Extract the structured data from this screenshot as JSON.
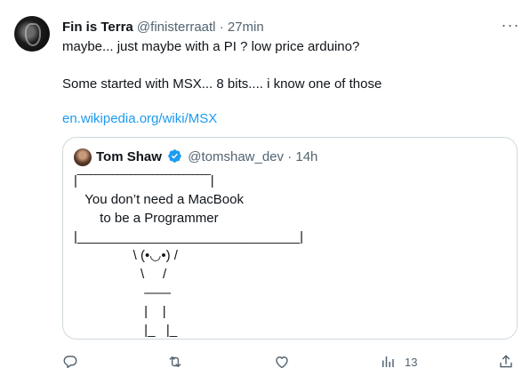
{
  "tweet": {
    "author_name": "Fin is Terra",
    "author_handle": "@finisterraatl",
    "separator": "·",
    "time": "27min",
    "line1": "maybe... just maybe with a PI ? low price arduino?",
    "line2": "Some started  with MSX... 8 bits.... i know one of those",
    "link": "en.wikipedia.org/wiki/MSX",
    "more_icon": "more-horizontal-icon"
  },
  "quote": {
    "author_name": "Tom Shaw",
    "author_handle": "@tomshaw_dev",
    "separator": "·",
    "time": "14h",
    "verified_icon": "verified-badge-icon",
    "verified_color": "#1d9bf0",
    "ascii_art": "|‾‾‾‾‾‾‾‾‾‾‾‾‾‾‾‾‾‾‾‾‾‾‾‾‾‾‾‾‾‾|\n   You don’t need a MacBook\n       to be a Programmer\n|______________________________|\n                \\ (•◡•) /\n                  \\     /\n                   ——\n                   |    |\n                   |_   |_"
  },
  "actions": {
    "reply_icon": "reply-icon",
    "retweet_icon": "retweet-icon",
    "like_icon": "like-icon",
    "views_icon": "views-icon",
    "views_count": "13",
    "share_icon": "share-icon"
  },
  "colors": {
    "text": "#0f1419",
    "muted": "#536471",
    "link": "#1d9bf0",
    "border": "#cfd9de"
  }
}
